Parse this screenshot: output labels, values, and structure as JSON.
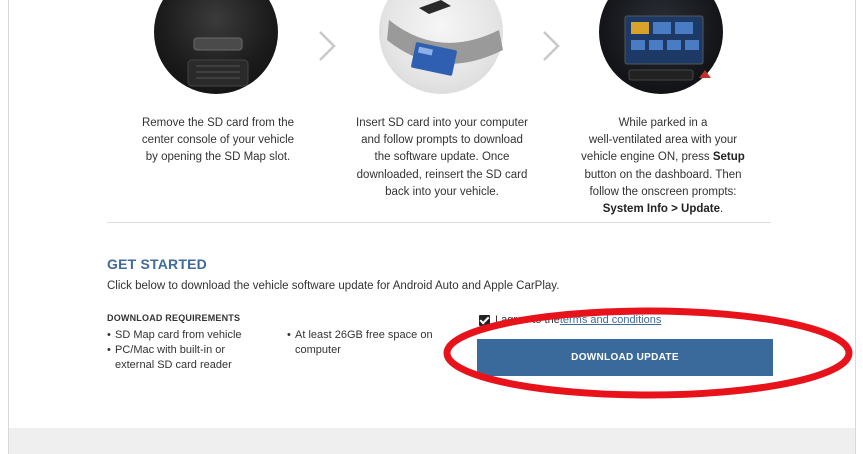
{
  "steps": [
    {
      "image": "sd-card-slot-console",
      "text_lines": [
        "Remove the SD card from the",
        "center console of your vehicle",
        "by opening the SD Map slot."
      ]
    },
    {
      "image": "sd-card-insert-computer",
      "text_lines": [
        "Insert SD card into your computer",
        "and follow prompts to download",
        "the software update. Once",
        "downloaded, reinsert the SD card",
        "back into your vehicle."
      ]
    },
    {
      "image": "vehicle-dashboard-screen",
      "text_lines": [
        "While parked in a",
        "well-ventilated area with your"
      ],
      "line3_pre": "vehicle engine ON, press ",
      "line3_bold": "Setup",
      "line4": "button on the dashboard. Then",
      "line5": "follow the onscreen prompts:",
      "line6_bold": "System Info > Update",
      "line6_post": "."
    }
  ],
  "arrow_icon": "chevron-right-icon",
  "get_started": {
    "title": "GET STARTED",
    "subtitle": "Click below to download the vehicle software update for Android Auto and Apple CarPlay."
  },
  "requirements": {
    "title": "DOWNLOAD REQUIREMENTS",
    "bullet": "•",
    "col1": [
      "SD Map card from vehicle",
      "PC/Mac with built-in or",
      "external SD card reader"
    ],
    "col2": [
      "At least 26GB free space on",
      "computer"
    ]
  },
  "agree": {
    "checked": true,
    "prefix": "I agree to the ",
    "link": "terms and conditions"
  },
  "download_button": {
    "label": "DOWNLOAD UPDATE"
  },
  "colors": {
    "accent": "#3a6a9c",
    "title_blue": "#3e6b9a",
    "annotation_red": "#e8121b"
  }
}
